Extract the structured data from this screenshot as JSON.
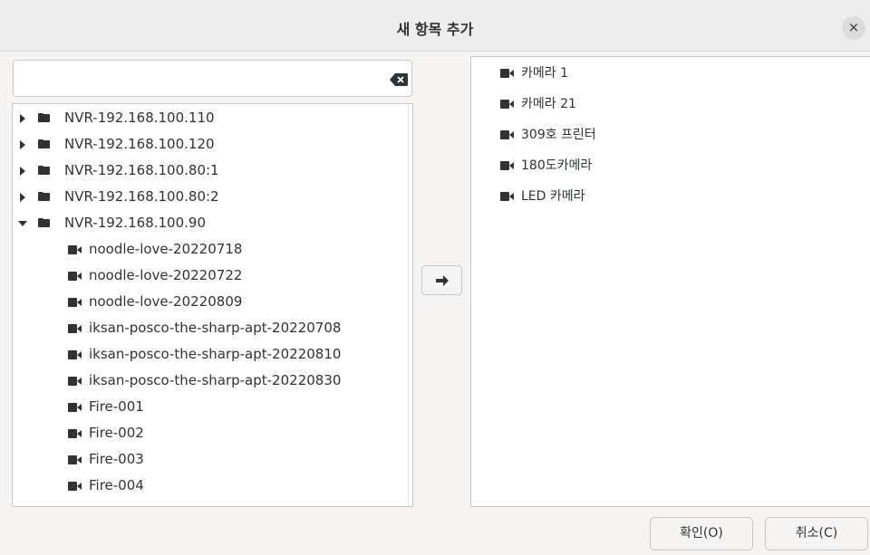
{
  "window": {
    "title": "새 항목 추가",
    "close_label": "×"
  },
  "search": {
    "value": "",
    "placeholder": ""
  },
  "tree": {
    "nodes": [
      {
        "type": "folder",
        "expanded": false,
        "label": "NVR-192.168.100.110"
      },
      {
        "type": "folder",
        "expanded": false,
        "label": "NVR-192.168.100.120"
      },
      {
        "type": "folder",
        "expanded": false,
        "label": "NVR-192.168.100.80:1"
      },
      {
        "type": "folder",
        "expanded": false,
        "label": "NVR-192.168.100.80:2"
      },
      {
        "type": "folder",
        "expanded": true,
        "label": "NVR-192.168.100.90"
      },
      {
        "type": "camera",
        "label": "noodle-love-20220718"
      },
      {
        "type": "camera",
        "label": "noodle-love-20220722"
      },
      {
        "type": "camera",
        "label": "noodle-love-20220809"
      },
      {
        "type": "camera",
        "label": "iksan-posco-the-sharp-apt-20220708"
      },
      {
        "type": "camera",
        "label": "iksan-posco-the-sharp-apt-20220810"
      },
      {
        "type": "camera",
        "label": "iksan-posco-the-sharp-apt-20220830"
      },
      {
        "type": "camera",
        "label": "Fire-001"
      },
      {
        "type": "camera",
        "label": "Fire-002"
      },
      {
        "type": "camera",
        "label": "Fire-003"
      },
      {
        "type": "camera",
        "label": "Fire-004"
      }
    ]
  },
  "selected": {
    "items": [
      {
        "label": "카메라 1"
      },
      {
        "label": "카메라 21"
      },
      {
        "label": "309호 프린터"
      },
      {
        "label": "180도카메라"
      },
      {
        "label": "LED 카메라"
      }
    ]
  },
  "icons": {
    "clear": "backspace-icon",
    "folder": "folder-icon",
    "camera": "video-camera-icon",
    "move": "arrow-right-icon"
  },
  "buttons": {
    "ok_label": "확인(O)",
    "cancel_label": "취소(C)"
  },
  "colors": {
    "icon": "#2e3436",
    "border": "#cdc7c2",
    "titlebar": "#ededed"
  }
}
